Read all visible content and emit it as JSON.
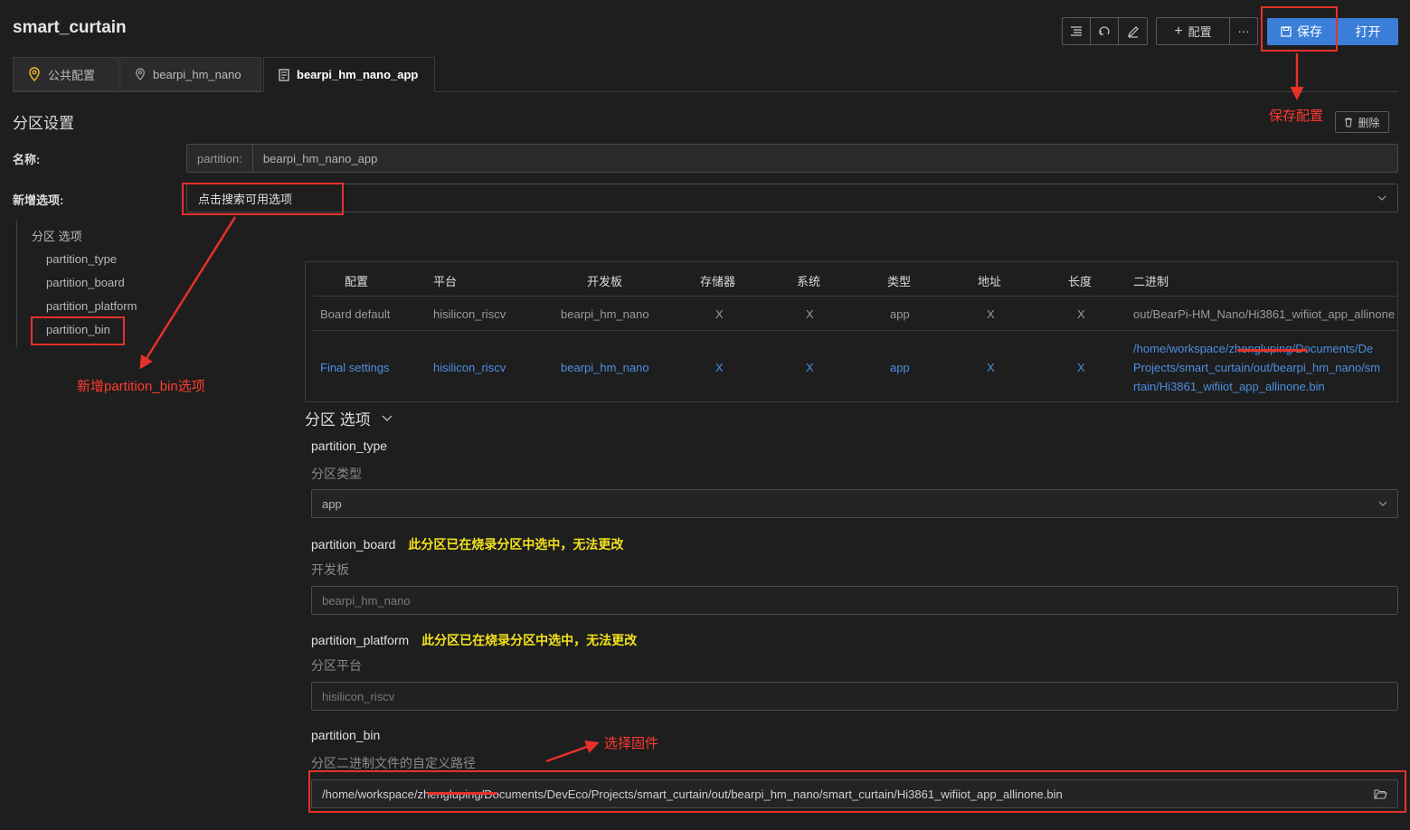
{
  "header": {
    "title": "smart_curtain",
    "add_config_label": "配置",
    "more_label": "···",
    "save_label": "保存",
    "open_label": "打开"
  },
  "tabs": [
    {
      "label": "公共配置",
      "icon": "location-pin-icon"
    },
    {
      "label": "bearpi_hm_nano",
      "icon": "location-pin-icon"
    },
    {
      "label": "bearpi_hm_nano_app",
      "icon": "document-icon"
    }
  ],
  "partition": {
    "section_title": "分区设置",
    "delete_label": "删除",
    "name_label": "名称:",
    "name_prefix": "partition:",
    "name_value": "bearpi_hm_nano_app",
    "add_option_label": "新增选项:",
    "add_option_placeholder": "点击搜索可用选项"
  },
  "tree": {
    "root": "分区 选项",
    "items": [
      "partition_type",
      "partition_board",
      "partition_platform",
      "partition_bin"
    ]
  },
  "table": {
    "headers": [
      "配置",
      "平台",
      "开发板",
      "存储器",
      "系统",
      "类型",
      "地址",
      "长度",
      "二进制"
    ],
    "rows": [
      [
        "Board default",
        "hisilicon_riscv",
        "bearpi_hm_nano",
        "X",
        "X",
        "app",
        "X",
        "X",
        "out/BearPi-HM_Nano/Hi3861_wifiiot_app_allinone"
      ],
      [
        "Final settings",
        "hisilicon_riscv",
        "bearpi_hm_nano",
        "X",
        "X",
        "app",
        "X",
        "X",
        "/home/workspace/zhengluping/Documents/DevEco/Projects/smart_curtain/out/bearpi_hm_nano/smart_curtain/Hi3861_wifiiot_app_allinone.bin"
      ]
    ],
    "final_bin_lines": [
      "/home/workspace/zhengluping/Documents/De",
      "Projects/smart_curtain/out/bearpi_hm_nano/sm",
      "rtain/Hi3861_wifiiot_app_allinone.bin"
    ]
  },
  "options": {
    "title": "分区 选项",
    "partition_type": {
      "name": "partition_type",
      "desc": "分区类型",
      "value": "app"
    },
    "partition_board": {
      "name": "partition_board",
      "warning": "此分区已在烧录分区中选中，无法更改",
      "desc": "开发板",
      "value": "bearpi_hm_nano"
    },
    "partition_platform": {
      "name": "partition_platform",
      "warning": "此分区已在烧录分区中选中，无法更改",
      "desc": "分区平台",
      "value": "hisilicon_riscv"
    },
    "partition_bin": {
      "name": "partition_bin",
      "desc": "分区二进制文件的自定义路径",
      "value": "/home/workspace/zhengluping/Documents/DevEco/Projects/smart_curtain/out/bearpi_hm_nano/smart_curtain/Hi3861_wifiiot_app_allinone.bin"
    }
  },
  "annotations": {
    "save_config": "保存配置",
    "add_partition_bin": "新增partition_bin选项",
    "select_firmware": "选择固件"
  },
  "colors": {
    "accent": "#3a7ed8",
    "annotation_red": "#e5312a",
    "warning_yellow": "#f2e21b"
  }
}
